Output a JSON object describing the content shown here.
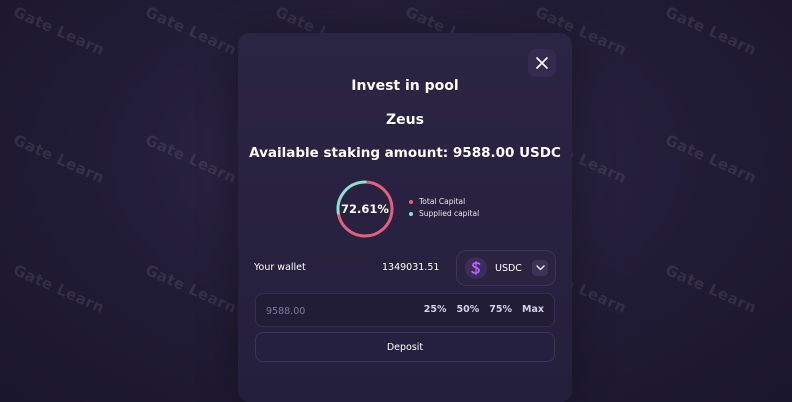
{
  "watermark": "Gate Learn",
  "modal": {
    "title": "Invest in pool",
    "pool_name": "Zeus",
    "available_text": "Available staking amount: 9588.00 USDC",
    "ratio": {
      "label": "72.61%",
      "value": 72.61
    },
    "legend": [
      {
        "label": "Total Capital",
        "color": "#e0607e"
      },
      {
        "label": "Supplied capital",
        "color": "#8fe0d2"
      }
    ],
    "wallet": {
      "label": "Your wallet",
      "balance": "1349031.51"
    },
    "token": {
      "name": "USDC",
      "icon": "token-s-icon"
    },
    "amount": {
      "value": "9588.00"
    },
    "percent_buttons": [
      "25%",
      "50%",
      "75%",
      "Max"
    ],
    "deposit_label": "Deposit"
  },
  "colors": {
    "accent_pink": "#e0607e",
    "accent_teal": "#8fe0d2",
    "token_purple": "#c55cff"
  }
}
